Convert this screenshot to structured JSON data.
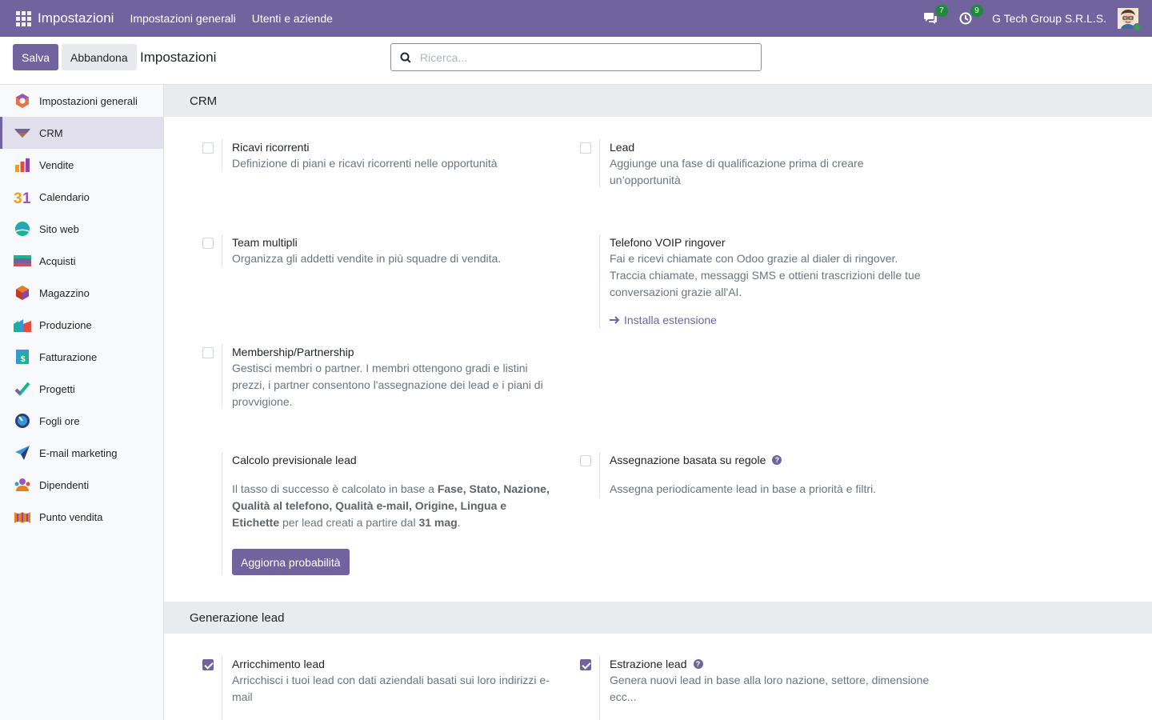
{
  "navbar": {
    "app_title": "Impostazioni",
    "menus": [
      "Impostazioni generali",
      "Utenti e aziende"
    ],
    "messages_count": "7",
    "activities_count": "9",
    "company": "G Tech Group S.R.L.S."
  },
  "control": {
    "save_label": "Salva",
    "discard_label": "Abbandona",
    "title": "Impostazioni",
    "search_placeholder": "Ricerca..."
  },
  "sidebar": {
    "items": [
      {
        "label": "Impostazioni generali",
        "icon": "settings-app-icon"
      },
      {
        "label": "CRM",
        "icon": "crm-app-icon",
        "active": true
      },
      {
        "label": "Vendite",
        "icon": "sales-app-icon"
      },
      {
        "label": "Calendario",
        "icon": "calendar-app-icon"
      },
      {
        "label": "Sito web",
        "icon": "website-app-icon"
      },
      {
        "label": "Acquisti",
        "icon": "purchase-app-icon"
      },
      {
        "label": "Magazzino",
        "icon": "inventory-app-icon"
      },
      {
        "label": "Produzione",
        "icon": "manufacturing-app-icon"
      },
      {
        "label": "Fatturazione",
        "icon": "invoicing-app-icon"
      },
      {
        "label": "Progetti",
        "icon": "project-app-icon"
      },
      {
        "label": "Fogli ore",
        "icon": "timesheet-app-icon"
      },
      {
        "label": "E-mail marketing",
        "icon": "email-marketing-app-icon"
      },
      {
        "label": "Dipendenti",
        "icon": "employees-app-icon"
      },
      {
        "label": "Punto vendita",
        "icon": "pos-app-icon"
      }
    ]
  },
  "crm_section": {
    "title": "CRM",
    "recurring": {
      "label": "Ricavi ricorrenti",
      "desc": "Definizione di piani e ricavi ricorrenti nelle opportunità",
      "checked": false
    },
    "leads": {
      "label": "Lead",
      "desc": "Aggiunge una fase di qualificazione prima di creare un’opportunità",
      "checked": false
    },
    "multi_teams": {
      "label": "Team multipli",
      "desc": "Organizza gli addetti vendite in più squadre di vendita.",
      "checked": false
    },
    "voip": {
      "label": "Telefono VOIP ringover",
      "desc": "Fai e ricevi chiamate con Odoo grazie al dialer di ringover. Traccia chiamate, messaggi SMS e ottieni trascrizioni delle tue conversazioni grazie all'AI.",
      "link": "Installa estensione"
    },
    "membership": {
      "label": "Membership/Partnership",
      "desc": "Gestisci membri o partner. I membri ottengono gradi e listini prezzi, i partner consentono l'assegnazione dei lead e i piani di provvigione.",
      "checked": false
    },
    "predictive": {
      "label": "Calcolo previsionale lead",
      "desc_1": "Il tasso di successo è calcolato in base a ",
      "fields": "Fase, Stato, Nazione, Qualità al telefono, Qualità e-mail, Origine, Lingua e Etichette",
      "desc_2": " per lead creati a partire dal ",
      "date": "31 mag",
      "desc_3": ".",
      "button": "Aggiorna probabilità"
    },
    "rule_assign": {
      "label": "Assegnazione basata su regole",
      "desc": "Assegna periodicamente lead in base a priorità e filtri.",
      "checked": false
    }
  },
  "lead_gen_section": {
    "title": "Generazione lead",
    "enrich": {
      "label": "Arricchimento lead",
      "desc": "Arricchisci i tuoi lead con dati aziendali basati sui loro indirizzi e-mail",
      "checked": true
    },
    "mining": {
      "label": "Estrazione lead",
      "desc": "Genera nuovi lead in base alla loro nazione, settore, dimensione ecc...",
      "checked": true
    }
  },
  "colors": {
    "brand": "#71639e",
    "badge": "#1f8a3c"
  }
}
